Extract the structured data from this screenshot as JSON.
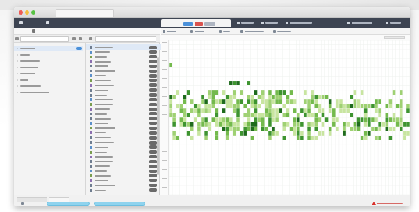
{
  "window": {
    "title": ""
  },
  "topnav": {
    "items": [
      {
        "icon": "home-icon",
        "label": ""
      },
      {
        "icon": "user-icon",
        "label": ""
      }
    ],
    "active_tab_label": "",
    "toolbar": [
      {
        "icon": "grid-icon",
        "label": ""
      },
      {
        "icon": "settings-icon",
        "label": ""
      },
      {
        "icon": "database-icon",
        "label": ""
      },
      {
        "icon": "view-icon",
        "label": ""
      },
      {
        "icon": "menu-icon",
        "label": ""
      }
    ]
  },
  "left": {
    "breadcrumb": "",
    "search_placeholder": "",
    "filter_placeholder": "",
    "tree": [
      {
        "label": "",
        "selected": true,
        "badge": ""
      },
      {
        "label": ""
      },
      {
        "label": ""
      },
      {
        "label": ""
      },
      {
        "label": ""
      },
      {
        "label": ""
      },
      {
        "label": ""
      },
      {
        "label": ""
      }
    ],
    "list_count": 31
  },
  "footer": {
    "tabs": [
      {
        "label": ""
      },
      {
        "label": ""
      }
    ],
    "pills": [
      "",
      ""
    ],
    "warning": ""
  },
  "right": {
    "toolbar": [
      {
        "icon": "back-icon",
        "label": ""
      },
      {
        "icon": "filter-icon",
        "label": ""
      },
      {
        "icon": "calendar-icon",
        "label": ""
      },
      {
        "icon": "list-icon",
        "label": ""
      },
      {
        "icon": "chart-icon",
        "label": ""
      }
    ],
    "heatmap": {
      "palette": {
        "l1": "#c8e5a0",
        "l2": "#9fd173",
        "l3": "#74ba4d",
        "l4": "#3e9430",
        "l5": "#1f6b1d"
      }
    }
  }
}
